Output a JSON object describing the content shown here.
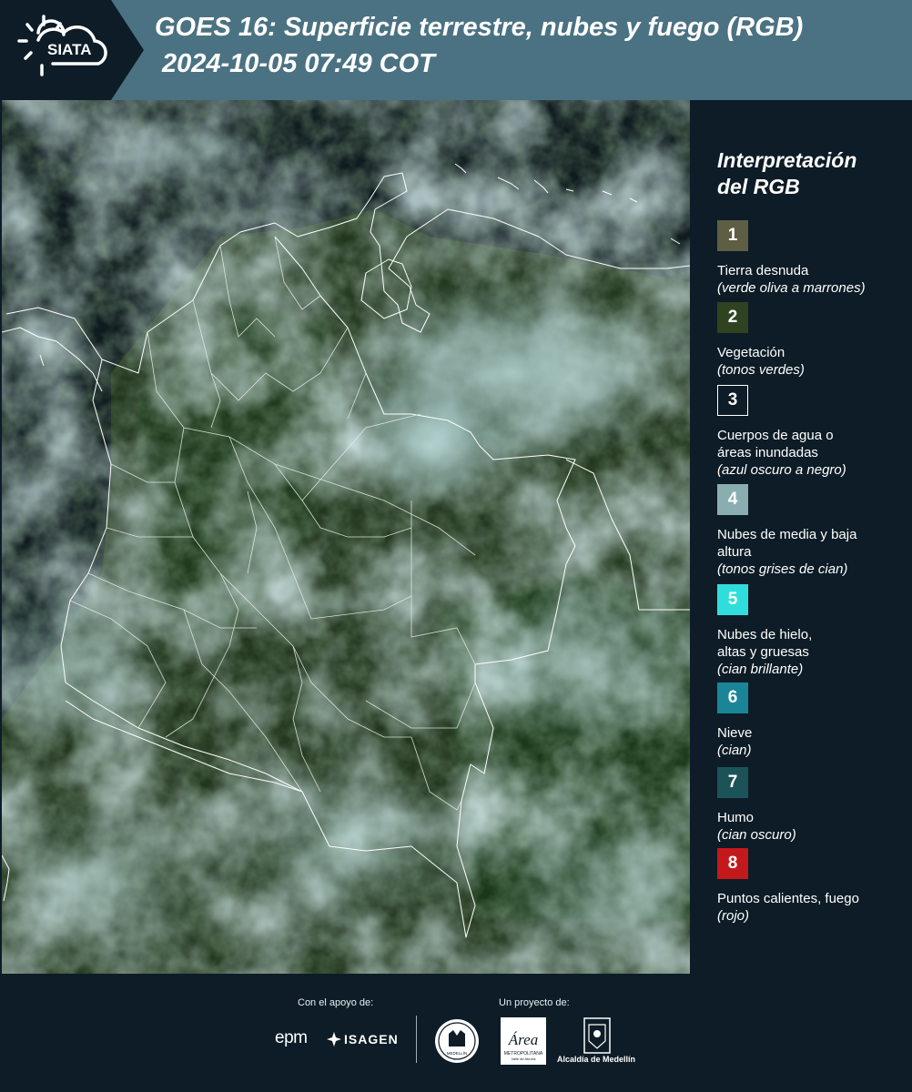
{
  "header": {
    "logo_text": "SIATA",
    "title_line1": "GOES 16: Superficie terrestre, nubes y fuego (RGB)",
    "title_line2": "2024-10-05 07:49 COT"
  },
  "legend": {
    "title_line1": "Interpretación",
    "title_line2": "del RGB",
    "items": [
      {
        "num": "1",
        "label": "Tierra desnuda",
        "desc": "(verde oliva a marrones)",
        "color": "#5e5e45"
      },
      {
        "num": "2",
        "label": "Vegetación",
        "desc": "(tonos verdes)",
        "color": "#2f4321"
      },
      {
        "num": "3",
        "label": "Cuerpos de agua o áreas inundadas",
        "desc": "(azul oscuro a negro)",
        "color": "#0d1c26"
      },
      {
        "num": "4",
        "label": "Nubes de media y baja altura",
        "desc": "(tonos grises de cian)",
        "color": "#8aaeb0"
      },
      {
        "num": "5",
        "label": "Nubes de hielo, altas y gruesas",
        "desc": "(cian brillante)",
        "color": "#2fdedc"
      },
      {
        "num": "6",
        "label": "Nieve",
        "desc": "(cian)",
        "color": "#1b8598"
      },
      {
        "num": "7",
        "label": "Humo",
        "desc": "(cian oscuro)",
        "color": "#1c5359"
      },
      {
        "num": "8",
        "label": "Puntos calientes, fuego",
        "desc": "(rojo)",
        "color": "#c4191c"
      }
    ]
  },
  "footer": {
    "support_label": "Con el apoyo de:",
    "project_label": "Un proyecto de:",
    "sponsor_epm": "epm",
    "sponsor_isagen": "ISAGEN",
    "seal_text": "MEDELLÍN",
    "area_text": "Área",
    "area_sub1": "METROPOLITANA",
    "area_sub2": "Valle de Aburrá",
    "alcaldia": "Alcaldía de Medellín"
  }
}
